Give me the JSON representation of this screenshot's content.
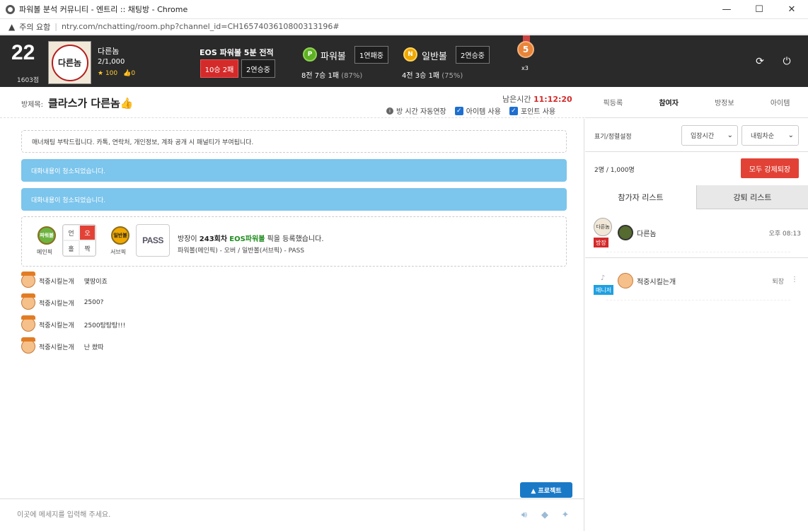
{
  "window": {
    "title": "파워볼 분석 커뮤니티 - 엔트리 :: 채팅방 - Chrome",
    "controls": {
      "minimize": "—",
      "maximize": "☐",
      "close": "✕"
    }
  },
  "address": {
    "warning_label": "주의 요함",
    "url": "ntry.com/nchatting/room.php?channel_id=CH1657403610800313196#"
  },
  "profile": {
    "level": "22",
    "points": "1603점",
    "avatar_text": "다른놈",
    "nickname": "다른놈",
    "count": "2/1,000",
    "stars": "100",
    "likes": "0"
  },
  "eos": {
    "title": "EOS 파워볼 5분 전적",
    "record": "10승 2패",
    "streak": "2연승중"
  },
  "powerball": {
    "coin": "P",
    "label": "파워볼",
    "streak": "1연패중",
    "stat": "8전 7승 1패",
    "pct": "(87%)"
  },
  "normalball": {
    "coin": "N",
    "label": "일반볼",
    "streak": "2연승중",
    "stat": "4전 3승 1패",
    "pct": "(75%)"
  },
  "medal": {
    "number": "5",
    "multiplier": "x3"
  },
  "header_icons": [
    "refresh-icon",
    "power-icon"
  ],
  "room": {
    "label": "방제목:",
    "title": "클라스가 다른놈👍",
    "remaining_label": "남은시간",
    "remaining_time": "11:12:20",
    "auto_extend": "방 시간 자동연장",
    "item_use": "아이템 사용",
    "point_use": "포인트 사용"
  },
  "right_tabs": [
    "픽등록",
    "참여자",
    "방정보",
    "아이템"
  ],
  "chat": {
    "notice": "매너채팅 부탁드립니다. 카톡, 연락처, 개인정보, 계좌 공개 시 패널티가 부여됩니다.",
    "system_messages": [
      "대화내용이 청소되었습니다.",
      "대화내용이 청소되었습니다."
    ],
    "pick": {
      "main_badge": "파워볼",
      "main_caption": "메인픽",
      "grid": [
        "언",
        "오",
        "홀",
        "짝"
      ],
      "sub_badge": "일반볼",
      "sub_caption": "서브픽",
      "pass": "PASS",
      "line1_prefix": "방장이",
      "line1_round": "243회차",
      "line1_game": "EOS파워볼",
      "line1_suffix": "픽을 등록했습니다.",
      "line2": "파워볼(메인픽) - 오버 / 일반볼(서브픽) - PASS"
    },
    "messages": [
      {
        "nick": "적중시킬는개",
        "text": "몇땅이죠"
      },
      {
        "nick": "적중시킬는개",
        "text": "2500?"
      },
      {
        "nick": "적중시킬는개",
        "text": "2500탕탕탕!!!"
      },
      {
        "nick": "적중시킬는개",
        "text": "난 쐈따"
      }
    ],
    "protect_button": "▲ 프로젝트"
  },
  "input": {
    "placeholder": "이곳에 메세지를 입력해 주세요."
  },
  "panel": {
    "sort_label": "표기/정렬설정",
    "sort_by": "입장시간",
    "sort_order": "내림차순",
    "count": "2명 / 1,000명",
    "kick_all": "모두 강제퇴장",
    "tabs": [
      "참가자 리스트",
      "강퇴 리스트"
    ],
    "participants": [
      {
        "avatar": "다른놈",
        "role": "방장",
        "nick": "다른놈",
        "time": "오후 08:13"
      },
      {
        "avatar": "♪",
        "role": "매니저",
        "nick": "적중시킬는개",
        "action": "퇴장",
        "more": "⋮"
      }
    ]
  }
}
